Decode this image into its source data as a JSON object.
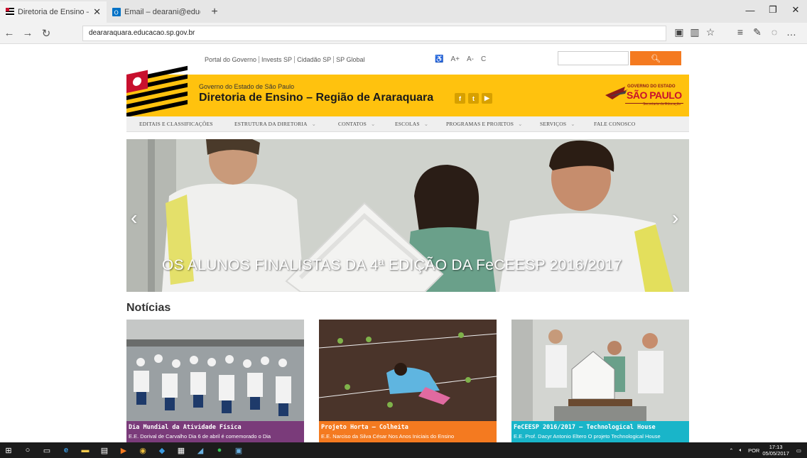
{
  "browser": {
    "tabs": [
      {
        "title": "Diretoria de Ensino – Re",
        "active": true
      },
      {
        "title": "Email – dearani@educacao",
        "active": false
      }
    ],
    "url": "deararaquara.educacao.sp.gov.br"
  },
  "header": {
    "top_links": [
      "Portal do Governo",
      "Invests SP",
      "Cidadão SP",
      "SP Global"
    ],
    "accessibility": [
      "A+",
      "A-",
      "C"
    ],
    "search_placeholder": "",
    "gov_small": "Governo do Estado de São Paulo",
    "title": "Diretoria de Ensino – Região de Araraquara",
    "social": [
      "f",
      "t",
      "▶"
    ],
    "logo_top": "GOVERNO DO ESTADO",
    "logo_main": "SÃO PAULO",
    "logo_sub": "Secretaria da Educação"
  },
  "menu": [
    {
      "label": "EDITAIS E CLASSIFICAÇÕES",
      "caret": ""
    },
    {
      "label": "ESTRUTURA DA DIRETORIA",
      "caret": "⌄"
    },
    {
      "label": "CONTATOS",
      "caret": "⌄"
    },
    {
      "label": "ESCOLAS",
      "caret": "⌄"
    },
    {
      "label": "PROGRAMAS E PROJETOS",
      "caret": "⌄"
    },
    {
      "label": "SERVIÇOS",
      "caret": "⌄"
    },
    {
      "label": "FALE CONOSCO",
      "caret": ""
    }
  ],
  "slider": {
    "caption": "OS ALUNOS FINALISTAS DA 4ª EDIÇÃO DA FeCEESP 2016/2017"
  },
  "news": {
    "title": "Notícias",
    "cards": [
      {
        "headline": "Dia Mundial da Atividade Física",
        "summary": "E.E. Dorival de Carvalho    Dia 6 de abril é comemorado o Dia",
        "color": "#7a3b7a"
      },
      {
        "headline": "Projeto Horta – Colheita",
        "summary": "E.E. Narciso da Silva César Nos Anos Iniciais do Ensino",
        "color": "#f47a20"
      },
      {
        "headline": "FeCEESP 2016/2017 – Technological House",
        "summary": "E.E. Prof. Dacyr Antonio Eltero   O projeto Technological House",
        "color": "#19b5c9"
      }
    ]
  },
  "taskbar": {
    "lang": "POR",
    "time": "17:13",
    "date": "05/05/2017"
  },
  "colors": {
    "banner_yellow": "#ffc20e",
    "search_orange": "#f47a20"
  }
}
